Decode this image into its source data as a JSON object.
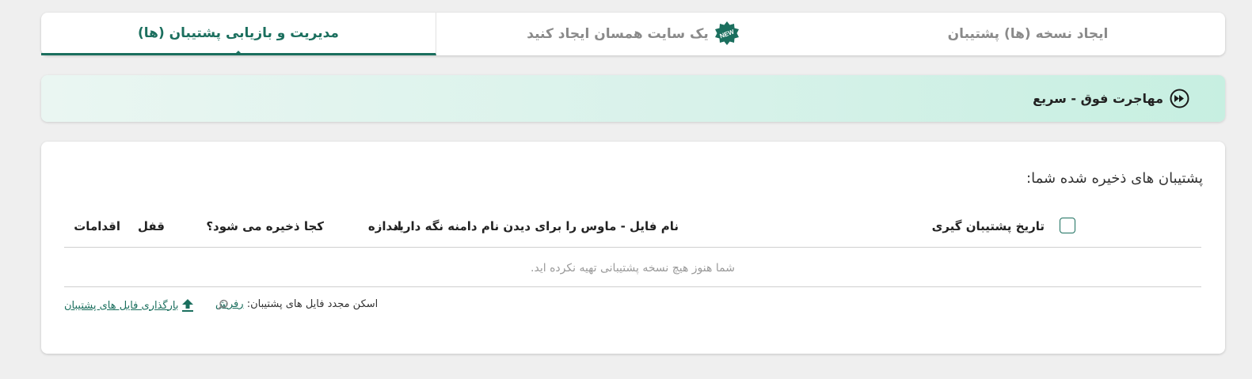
{
  "tabs": [
    {
      "label": "ایجاد نسخه (ها) پشتیبان"
    },
    {
      "label": "یک سایت همسان ایجاد کنید",
      "badge": "NEW"
    },
    {
      "label": "مدیریت و بازیابی پشتیبان (ها)"
    }
  ],
  "banner": {
    "title": "مهاجرت فوق - سریع",
    "icon": "fast-forward-circle-icon"
  },
  "backups": {
    "title": "پشتیبان های ذخیره شده شما:",
    "columns": {
      "date": "تاریخ پشتیبان گیری",
      "filename": "نام فایل - ماوس را برای دیدن نام دامنه نگه دارید",
      "size": "اندازه",
      "location": "کجا ذخیره می شود؟",
      "lock": "قفل",
      "actions": "اقدامات"
    },
    "empty_message": "شما هنوز هیچ نسخه پشتیبانی تهیه نکرده اید.",
    "rescan_label": "اسکن مجدد فایل های پشتیبان:",
    "refresh_link": "رفرش",
    "upload_label": "بارگذاری فایل های پشتیبان"
  },
  "colors": {
    "accent": "#1b6f5e",
    "banner": "#d3f1e7"
  }
}
